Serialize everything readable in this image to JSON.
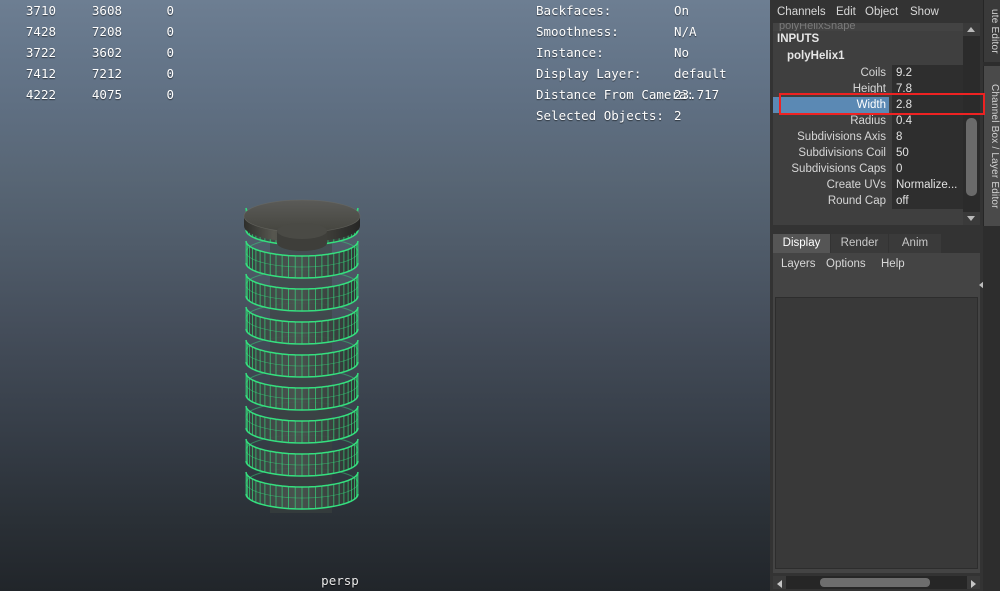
{
  "viewport": {
    "camera_label": "persp",
    "background_top_color": "#6d7e92",
    "background_bottom_color": "#21252a",
    "selection_wire_color": "#35e07f"
  },
  "poly_stats": {
    "rows": [
      {
        "c1": "3710",
        "c2": "3608",
        "c3": "0"
      },
      {
        "c1": "7428",
        "c2": "7208",
        "c3": "0"
      },
      {
        "c1": "3722",
        "c2": "3602",
        "c3": "0"
      },
      {
        "c1": "7412",
        "c2": "7212",
        "c3": "0"
      },
      {
        "c1": "4222",
        "c2": "4075",
        "c3": "0"
      }
    ]
  },
  "hud": {
    "rows": [
      {
        "label": "Backfaces:",
        "value": "On"
      },
      {
        "label": "Smoothness:",
        "value": "N/A"
      },
      {
        "label": "Instance:",
        "value": "No"
      },
      {
        "label": "Display Layer:",
        "value": "default"
      },
      {
        "label": "Distance From Camera:",
        "value": "23.717"
      },
      {
        "label": "Selected Objects:",
        "value": "2"
      }
    ]
  },
  "channel_box": {
    "menu": [
      "Channels",
      "Edit",
      "Object",
      "Show"
    ],
    "cut_off_row": "polyHelixShape",
    "section_label": "INPUTS",
    "node_name": "polyHelix1",
    "attributes": [
      {
        "name": "Coils",
        "value": "9.2",
        "selected": false
      },
      {
        "name": "Height",
        "value": "7.8",
        "selected": false
      },
      {
        "name": "Width",
        "value": "2.8",
        "selected": true
      },
      {
        "name": "Radius",
        "value": "0.4",
        "selected": false
      },
      {
        "name": "Subdivisions Axis",
        "value": "8",
        "selected": false
      },
      {
        "name": "Subdivisions Coil",
        "value": "50",
        "selected": false
      },
      {
        "name": "Subdivisions Caps",
        "value": "0",
        "selected": false
      },
      {
        "name": "Create UVs",
        "value": "Normalize...",
        "selected": false
      },
      {
        "name": "Round Cap",
        "value": "off",
        "selected": false
      }
    ],
    "highlight_color": "#5b89b4"
  },
  "editor_tabs": [
    {
      "label": "Display",
      "active": true
    },
    {
      "label": "Render",
      "active": false
    },
    {
      "label": "Anim",
      "active": false
    }
  ],
  "layer_editor": {
    "menu": [
      "Layers",
      "Options",
      "Help"
    ],
    "icons": [
      "layer-new-icon",
      "layer-new-from-selected-icon",
      "layer-add-selected-icon",
      "layer-remove-selected-icon"
    ]
  },
  "side_tabs": [
    {
      "label": "ute Editor",
      "active": false
    },
    {
      "label": "Channel Box / Layer Editor",
      "active": true
    }
  ],
  "annotation": {
    "target": "Width",
    "color": "#ee2222"
  }
}
